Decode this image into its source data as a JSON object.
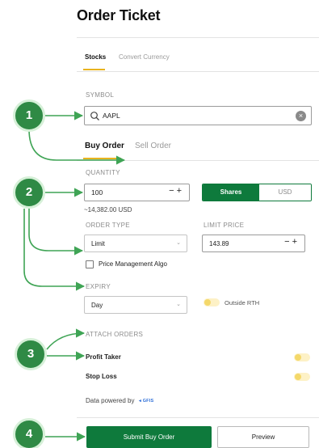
{
  "title": "Order Ticket",
  "top_tabs": [
    {
      "label": "Stocks",
      "active": true
    },
    {
      "label": "Convert Currency",
      "active": false
    }
  ],
  "symbol": {
    "label": "SYMBOL",
    "value": "AAPL",
    "clear_glyph": "×"
  },
  "order_tabs": [
    {
      "label": "Buy Order",
      "active": true
    },
    {
      "label": "Sell Order",
      "active": false
    }
  ],
  "quantity": {
    "label": "QUANTITY",
    "value": "100",
    "stepper": "−+",
    "approx": "~14,382.00 USD",
    "unit_options": [
      "Shares",
      "USD"
    ],
    "selected_unit": "Shares"
  },
  "order_type": {
    "label": "ORDER TYPE",
    "value": "Limit",
    "chevron": "⌄"
  },
  "limit_price": {
    "label": "LIMIT PRICE",
    "value": "143.89",
    "stepper": "−+"
  },
  "price_mgmt": {
    "label": "Price Management Algo",
    "checked": false
  },
  "expiry": {
    "label": "EXPIRY",
    "value": "Day",
    "chevron": "⌄"
  },
  "outside_rth": {
    "label": "Outside RTH",
    "on": false
  },
  "attach_orders": {
    "label": "ATTACH ORDERS",
    "items": [
      {
        "label": "Profit Taker",
        "on": false
      },
      {
        "label": "Stop Loss",
        "on": false
      }
    ]
  },
  "powered_by": {
    "label": "Data powered by",
    "logo_text": "◂ GFIS"
  },
  "buttons": {
    "submit": "Submit Buy Order",
    "preview": "Preview"
  },
  "steps": [
    "1",
    "2",
    "3",
    "4"
  ],
  "colors": {
    "brand_green": "#0e7a3c",
    "step_green": "#2f8a45",
    "tab_accent": "#e8b31e",
    "arrow_green": "#3fa455"
  }
}
